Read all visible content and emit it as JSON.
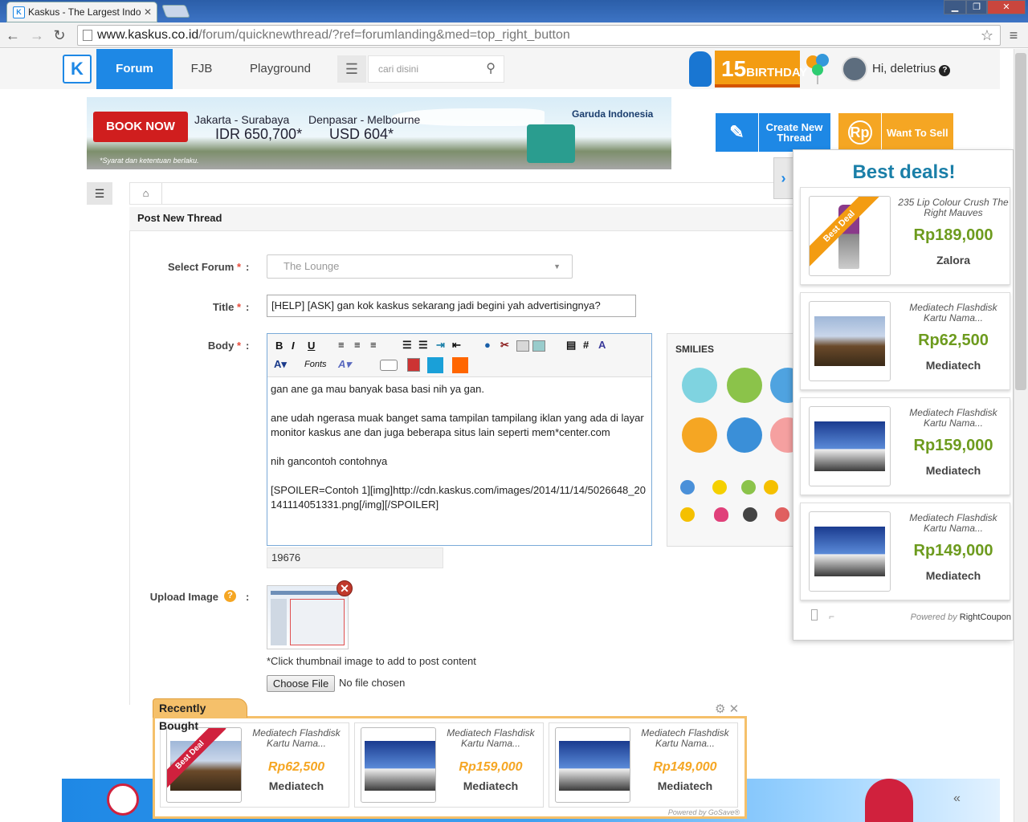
{
  "browser": {
    "tab_title": "Kaskus - The Largest Indo",
    "url_host": "www.kaskus.co.id",
    "url_path": "/forum/quicknewthread/?ref=forumlanding&med=top_right_button"
  },
  "header": {
    "logo": "K",
    "nav": [
      "Forum",
      "FJB",
      "Playground"
    ],
    "search_placeholder": "cari disini",
    "birthday": "BIRTHDAY",
    "birthday_num": "15",
    "greeting": "Hi, deletrius"
  },
  "banner": {
    "cta": "BOOK NOW",
    "route1": "Jakarta - Surabaya",
    "price1": "IDR 650,700*",
    "route2": "Denpasar - Melbourne",
    "price2": "USD 604*",
    "brand": "Garuda Indonesia",
    "note": "*Syarat dan ketentuan berlaku."
  },
  "actions": {
    "create": "Create New Thread",
    "sell": "Want To Sell",
    "sell_icon": "Rp"
  },
  "form": {
    "title": "Post New Thread",
    "labels": {
      "forum": "Select Forum",
      "title": "Title",
      "body": "Body",
      "upload": "Upload Image"
    },
    "forum_value": "The Lounge",
    "title_value": "[HELP] [ASK] gan kok kaskus sekarang jadi begini yah advertisingnya?",
    "toolbar": {
      "fonts": "Fonts"
    },
    "body_lines": [
      "gan ane ga mau banyak basa basi nih ya gan.",
      "",
      "ane udah ngerasa muak banget sama tampilan tampilang iklan yang ada di layar monitor kaskus ane dan juga beberapa situs lain seperti mem*center.com",
      "",
      "nih gancontoh contohnya",
      "",
      "[SPOILER=Contoh 1][img]http://cdn.kaskus.com/images/2014/11/14/5026648_20141114051331.png[/img][/SPOILER]"
    ],
    "counter": "19676",
    "smilies_title": "SMILIES",
    "thumb_note": "*Click thumbnail image to add to post content",
    "choose_file": "Choose File",
    "no_file": "No file chosen"
  },
  "deals": {
    "title": "Best deals!",
    "ribbon": "Best Deal",
    "items": [
      {
        "name": "235 Lip Colour Crush The Right Mauves",
        "price": "Rp189,000",
        "store": "Zalora"
      },
      {
        "name": "Mediatech Flashdisk Kartu Nama...",
        "price": "Rp62,500",
        "store": "Mediatech"
      },
      {
        "name": "Mediatech Flashdisk Kartu Nama...",
        "price": "Rp159,000",
        "store": "Mediatech"
      },
      {
        "name": "Mediatech Flashdisk Kartu Nama...",
        "price": "Rp149,000",
        "store": "Mediatech"
      }
    ],
    "powered_prefix": "Powered by",
    "powered_brand": "RightCoupon"
  },
  "recent": {
    "title": "Recently Bought",
    "ribbon": "Best Deal",
    "items": [
      {
        "name": "Mediatech Flashdisk Kartu Nama...",
        "price": "Rp62,500",
        "store": "Mediatech"
      },
      {
        "name": "Mediatech Flashdisk Kartu Nama...",
        "price": "Rp159,000",
        "store": "Mediatech"
      },
      {
        "name": "Mediatech Flashdisk Kartu Nama...",
        "price": "Rp149,000",
        "store": "Mediatech"
      }
    ],
    "powered": "Powered by GoSave®"
  }
}
